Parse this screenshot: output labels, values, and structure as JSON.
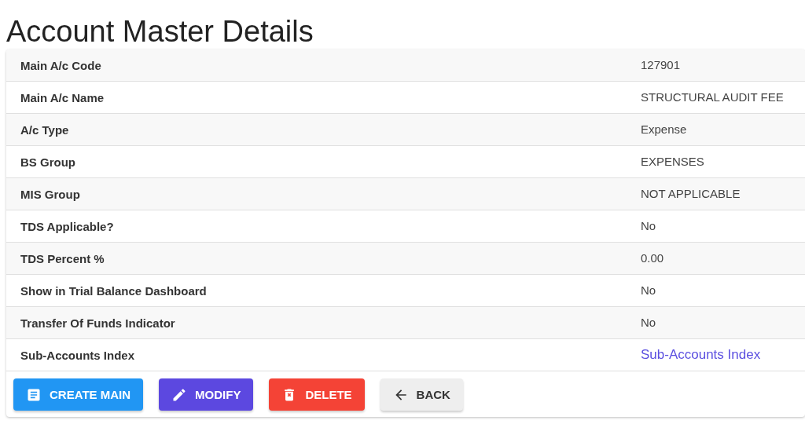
{
  "title": "Account Master Details",
  "rows": [
    {
      "label": "Main A/c Code",
      "value": "127901",
      "kind": "text"
    },
    {
      "label": "Main A/c Name",
      "value": "STRUCTURAL AUDIT FEE",
      "kind": "text"
    },
    {
      "label": "A/c Type",
      "value": "Expense",
      "kind": "text"
    },
    {
      "label": "BS Group",
      "value": "EXPENSES",
      "kind": "text"
    },
    {
      "label": "MIS Group",
      "value": "NOT APPLICABLE",
      "kind": "text"
    },
    {
      "label": "TDS Applicable?",
      "value": "No",
      "kind": "text"
    },
    {
      "label": "TDS Percent %",
      "value": "0.00",
      "kind": "text"
    },
    {
      "label": "Show in Trial Balance Dashboard",
      "value": "No",
      "kind": "text"
    },
    {
      "label": "Transfer Of Funds Indicator",
      "value": "No",
      "kind": "text"
    },
    {
      "label": "Sub-Accounts Index",
      "value": "Sub-Accounts Index",
      "kind": "link"
    }
  ],
  "buttons": [
    {
      "label": "CREATE MAIN",
      "kind": "create"
    },
    {
      "label": "MODIFY",
      "kind": "modify"
    },
    {
      "label": "DELETE",
      "kind": "delete"
    },
    {
      "label": "BACK",
      "kind": "back"
    }
  ]
}
